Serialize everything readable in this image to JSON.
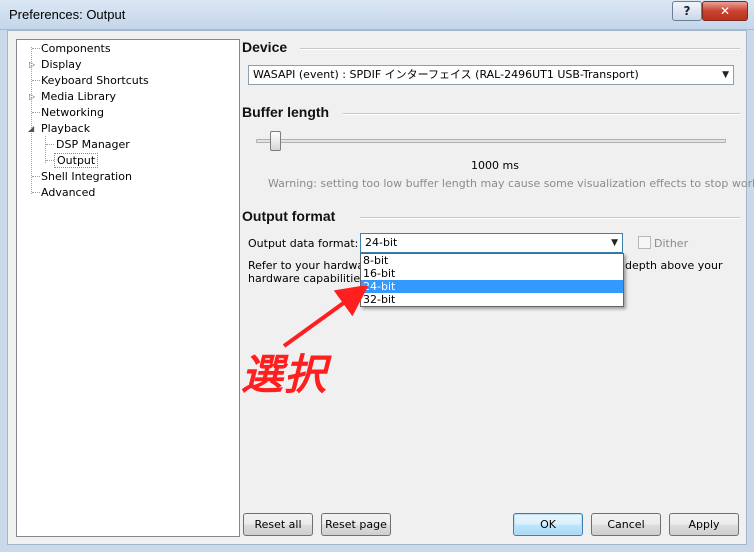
{
  "window": {
    "title": "Preferences: Output",
    "help_label": "?",
    "close_label": "✕"
  },
  "tree": {
    "items": [
      {
        "label": "Components"
      },
      {
        "label": "Display"
      },
      {
        "label": "Keyboard Shortcuts"
      },
      {
        "label": "Media Library"
      },
      {
        "label": "Networking"
      },
      {
        "label": "Playback"
      },
      {
        "label": "DSP Manager"
      },
      {
        "label": "Output"
      },
      {
        "label": "Shell Integration"
      },
      {
        "label": "Advanced"
      }
    ],
    "selected": "Output"
  },
  "device": {
    "title": "Device",
    "value": "WASAPI (event) : SPDIF インターフェイス (RAL-2496UT1 USB-Transport)"
  },
  "buffer": {
    "title": "Buffer length",
    "value_label": "1000 ms",
    "warning": "Warning: setting too low buffer length may cause some visualization effects to stop working."
  },
  "output_format": {
    "title": "Output format",
    "field_label": "Output data format:",
    "value": "24-bit",
    "dither_label": "Dither",
    "dither_checked": false,
    "note_line1_left": "Refer to your hardwar",
    "note_line1_right": "depth above your",
    "note_line2_left": "hardware capabilities w",
    "options": [
      "8-bit",
      "16-bit",
      "24-bit",
      "32-bit"
    ],
    "highlighted": "24-bit"
  },
  "annotation": {
    "text": "選択",
    "color": "#ff1f1f"
  },
  "buttons": {
    "reset_all": "Reset all",
    "reset_page": "Reset page",
    "ok": "OK",
    "cancel": "Cancel",
    "apply": "Apply"
  }
}
